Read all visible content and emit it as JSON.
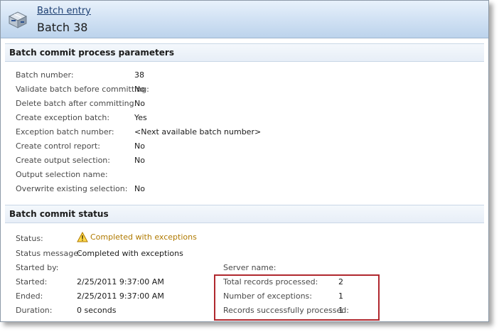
{
  "header": {
    "breadcrumb": "Batch entry",
    "title": "Batch 38",
    "icon": "batch-icon"
  },
  "parameters": {
    "section_title": "Batch commit process parameters",
    "rows": [
      {
        "label": "Batch number:",
        "value": "38"
      },
      {
        "label": "Validate batch before committing:",
        "value": "No"
      },
      {
        "label": "Delete batch after committing:",
        "value": "No"
      },
      {
        "label": "Create exception batch:",
        "value": "Yes"
      },
      {
        "label": "Exception batch number:",
        "value": "<Next available batch number>"
      },
      {
        "label": "Create control report:",
        "value": "No"
      },
      {
        "label": "Create output selection:",
        "value": "No"
      },
      {
        "label": "Output selection name:",
        "value": ""
      },
      {
        "label": "Overwrite existing selection:",
        "value": "No"
      }
    ]
  },
  "status": {
    "section_title": "Batch commit status",
    "status_label": "Status:",
    "status_value": "Completed with exceptions",
    "status_icon": "warning-icon",
    "message_label": "Status message:",
    "message_value": "Completed with exceptions",
    "started_by_label": "Started by:",
    "started_by_value": "",
    "started_label": "Started:",
    "started_value": "2/25/2011 9:37:00 AM",
    "ended_label": "Ended:",
    "ended_value": "2/25/2011 9:37:00 AM",
    "duration_label": "Duration:",
    "duration_value": "0 seconds",
    "server_label": "Server name:",
    "server_value": "",
    "total_label": "Total records processed:",
    "total_value": "2",
    "exceptions_label": "Number of exceptions:",
    "exceptions_value": "1",
    "success_label": "Records successfully processed:",
    "success_value": "1"
  },
  "colors": {
    "header_text": "#1d3f72",
    "warning": "#b07a00",
    "highlight": "#b0282e"
  }
}
